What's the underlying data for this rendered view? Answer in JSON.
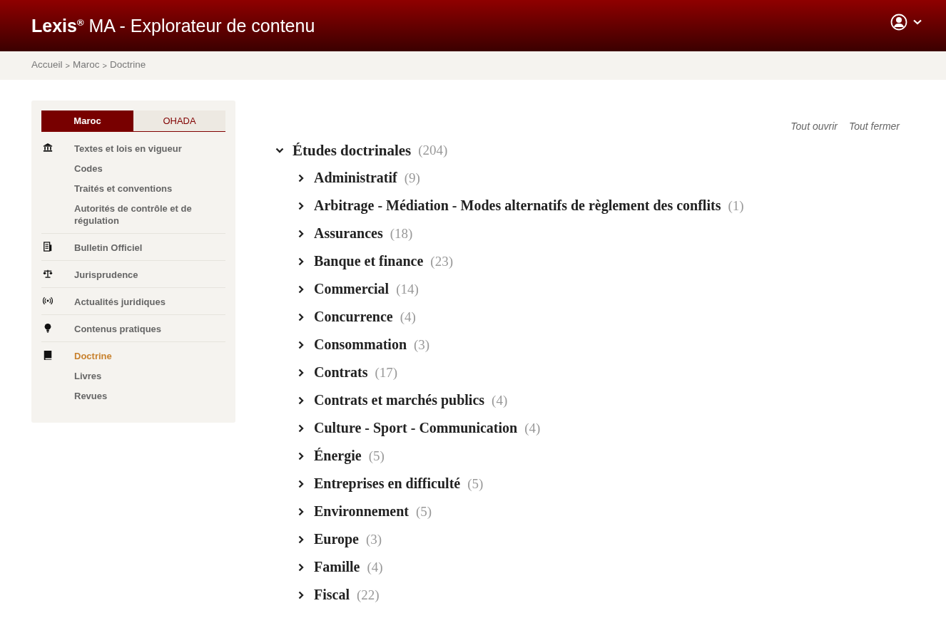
{
  "header": {
    "brand": "Lexis",
    "brand_mark": "®",
    "title": "MA - Explorateur de contenu"
  },
  "breadcrumb": {
    "items": [
      "Accueil",
      "Maroc",
      "Doctrine"
    ],
    "separator": ">"
  },
  "sidebar": {
    "tabs": [
      {
        "label": "Maroc",
        "selected": true
      },
      {
        "label": "OHADA",
        "selected": false
      }
    ],
    "groups": [
      {
        "kind": "institution",
        "items": [
          {
            "label": "Textes et lois en vigueur",
            "selected": false
          },
          {
            "label": "Codes",
            "selected": false
          },
          {
            "label": "Traités et conventions",
            "selected": false
          },
          {
            "label": "Autorités de contrôle et de régulation",
            "selected": false
          }
        ]
      },
      {
        "kind": "newspaper",
        "items": [
          {
            "label": "Bulletin Officiel",
            "selected": false
          }
        ]
      },
      {
        "kind": "scales",
        "items": [
          {
            "label": "Jurisprudence",
            "selected": false
          }
        ]
      },
      {
        "kind": "broadcast",
        "items": [
          {
            "label": "Actualités juridiques",
            "selected": false
          }
        ]
      },
      {
        "kind": "bulb",
        "items": [
          {
            "label": "Contenus pratiques",
            "selected": false
          }
        ]
      },
      {
        "kind": "book",
        "items": [
          {
            "label": "Doctrine",
            "selected": true
          },
          {
            "label": "Livres",
            "selected": false
          },
          {
            "label": "Revues",
            "selected": false
          }
        ]
      }
    ]
  },
  "actions": [
    "Tout ouvrir",
    "Tout fermer"
  ],
  "tree": [
    {
      "label": "Études doctrinales",
      "count": "(204)",
      "expanded": true,
      "children": [
        {
          "label": "Administratif",
          "count": "(9)",
          "expanded": false
        },
        {
          "label": "Arbitrage - Médiation - Modes alternatifs de règlement des conflits",
          "count": "(1)",
          "expanded": false
        },
        {
          "label": "Assurances",
          "count": "(18)",
          "expanded": false
        },
        {
          "label": "Banque et finance",
          "count": "(23)",
          "expanded": false
        },
        {
          "label": "Commercial",
          "count": "(14)",
          "expanded": false
        },
        {
          "label": "Concurrence",
          "count": "(4)",
          "expanded": false
        },
        {
          "label": "Consommation",
          "count": "(3)",
          "expanded": false
        },
        {
          "label": "Contrats",
          "count": "(17)",
          "expanded": false
        },
        {
          "label": "Contrats et marchés publics",
          "count": "(4)",
          "expanded": false
        },
        {
          "label": "Culture - Sport - Communication",
          "count": "(4)",
          "expanded": false
        },
        {
          "label": "Énergie",
          "count": "(5)",
          "expanded": false
        },
        {
          "label": "Entreprises en difficulté",
          "count": "(5)",
          "expanded": false
        },
        {
          "label": "Environnement",
          "count": "(5)",
          "expanded": false
        },
        {
          "label": "Europe",
          "count": "(3)",
          "expanded": false
        },
        {
          "label": "Famille",
          "count": "(4)",
          "expanded": false
        },
        {
          "label": "Fiscal",
          "count": "(22)",
          "expanded": false
        }
      ]
    }
  ]
}
